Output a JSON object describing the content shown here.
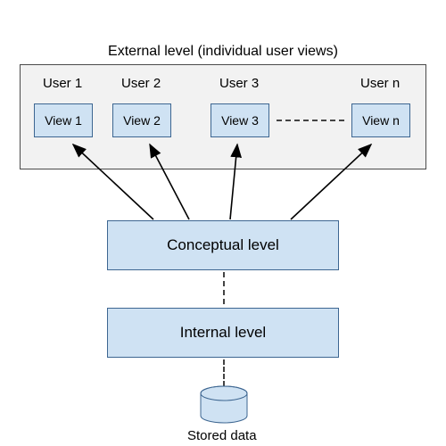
{
  "title_external": "External level (individual user views)",
  "users": [
    {
      "label": "User 1",
      "view": "View 1"
    },
    {
      "label": "User 2",
      "view": "View 2"
    },
    {
      "label": "User 3",
      "view": "View 3"
    },
    {
      "label": "User n",
      "view": "View n"
    }
  ],
  "conceptual": "Conceptual level",
  "internal": "Internal level",
  "stored": "Stored data"
}
